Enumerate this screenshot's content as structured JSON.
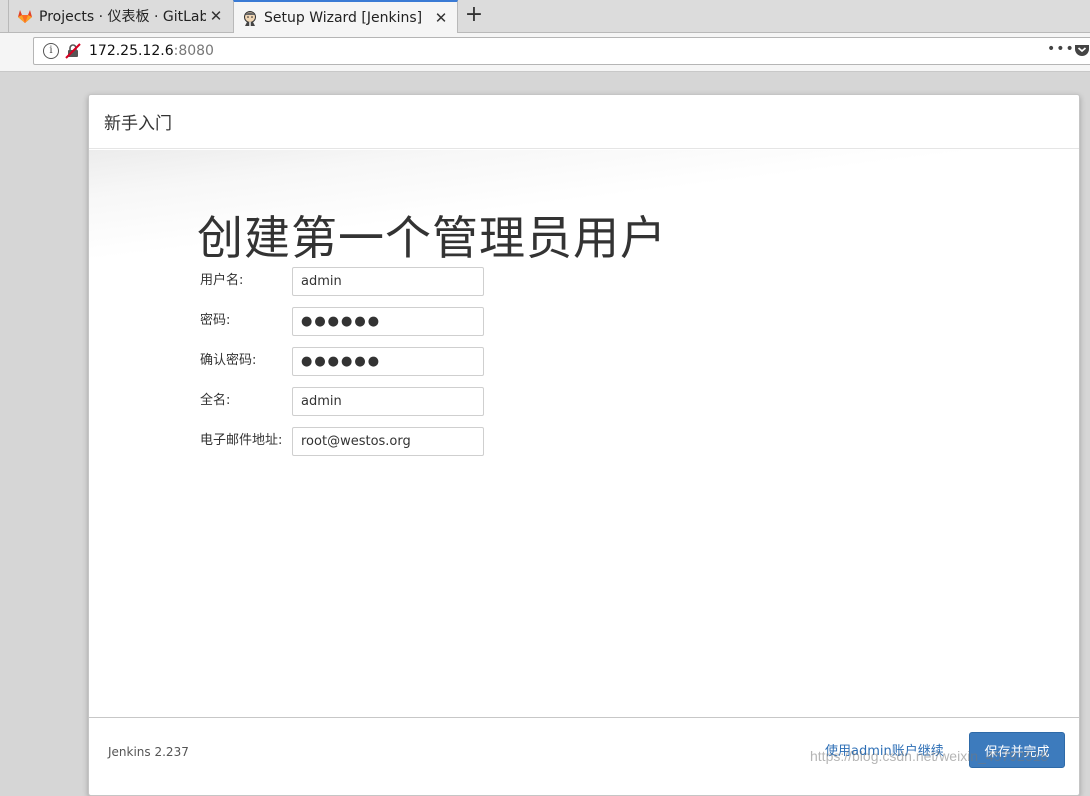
{
  "browser": {
    "tabs": [
      {
        "title": "Projects · 仪表板 · GitLab",
        "icon": "gitlab-fox-icon",
        "active": false
      },
      {
        "title": "Setup Wizard [Jenkins]",
        "icon": "jenkins-butler-icon",
        "active": true
      }
    ],
    "close_glyph": "✕",
    "new_tab_glyph": "+",
    "url": {
      "host": "172.25.12.6",
      "port": ":8080"
    },
    "page_actions_glyph": "•••",
    "info_glyph": "i"
  },
  "modal": {
    "header_title": "新手入门",
    "page_title": "创建第一个管理员用户",
    "fields": [
      {
        "label": "用户名:",
        "value": "admin",
        "type": "text"
      },
      {
        "label": "密码:",
        "value": "●●●●●●",
        "type": "password"
      },
      {
        "label": "确认密码:",
        "value": "●●●●●●",
        "type": "password"
      },
      {
        "label": "全名:",
        "value": "admin",
        "type": "text"
      },
      {
        "label": "电子邮件地址:",
        "value": "root@westos.org",
        "type": "text"
      }
    ],
    "footer": {
      "version": "Jenkins 2.237",
      "continue_link": "使用admin账户继续",
      "save_button": "保存并完成"
    }
  },
  "watermark": "https://blog.csdn.net/weixin_45792518",
  "colors": {
    "accent_tab": "#3a7bd5",
    "primary_button": "#3d7bbd",
    "link": "#2c6eb5"
  }
}
